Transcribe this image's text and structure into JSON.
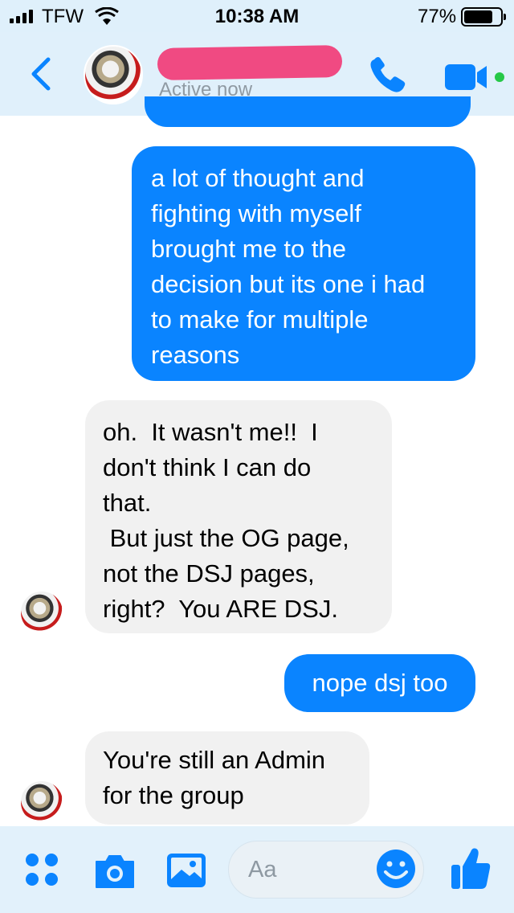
{
  "status_bar": {
    "carrier": "TFW",
    "time": "10:38 AM",
    "battery": "77%",
    "battery_level": 0.77
  },
  "header": {
    "status": "Active now"
  },
  "messages": [
    {
      "from": "me",
      "text": "a lot of thought and\nfighting with myself\nbrought me to the\ndecision but its one i had\nto make for multiple\nreasons"
    },
    {
      "from": "them",
      "text": "oh.  It wasn't me!!  I\ndon't think I can do\nthat.\n But just the OG page,\nnot the DSJ pages,\nright?  You ARE DSJ."
    },
    {
      "from": "me",
      "text": "nope dsj too"
    },
    {
      "from": "them",
      "text": "You're still an Admin\nfor the group"
    }
  ],
  "composer": {
    "placeholder": "Aa"
  },
  "colors": {
    "accent": "#0a84ff",
    "received_bubble": "#f1f1f1",
    "header_bg": "#e0f0fb",
    "online_dot": "#26c847",
    "redaction": "#f04a82"
  }
}
